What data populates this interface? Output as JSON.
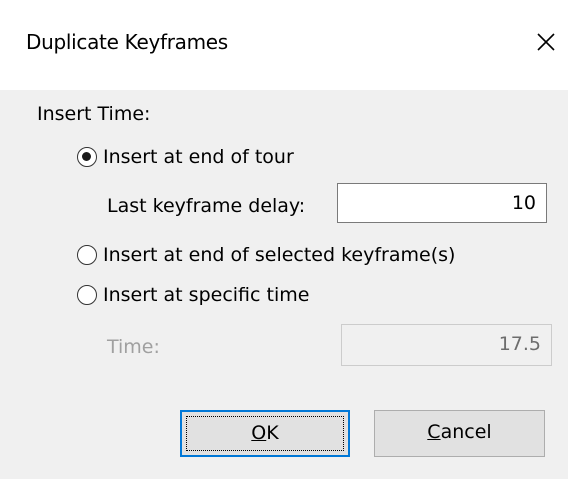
{
  "dialog": {
    "title": "Duplicate Keyframes",
    "close_icon": "close-icon"
  },
  "insert_time": {
    "group_label": "Insert Time:",
    "options": [
      {
        "label": "Insert at end of tour",
        "checked": true
      },
      {
        "label": "Insert at end of selected keyframe(s)",
        "checked": false
      },
      {
        "label": "Insert at specific time",
        "checked": false
      }
    ],
    "last_keyframe_delay": {
      "label": "Last keyframe delay:",
      "value": "10"
    },
    "time": {
      "label": "Time:",
      "value": "17.5",
      "disabled": true
    }
  },
  "buttons": {
    "ok": {
      "mnemonic": "O",
      "rest": "K"
    },
    "cancel": {
      "mnemonic": "C",
      "rest": "ancel"
    }
  },
  "colors": {
    "accent": "#0078d7",
    "client_bg": "#f0f0f0",
    "disabled_text": "#a0a0a0"
  }
}
